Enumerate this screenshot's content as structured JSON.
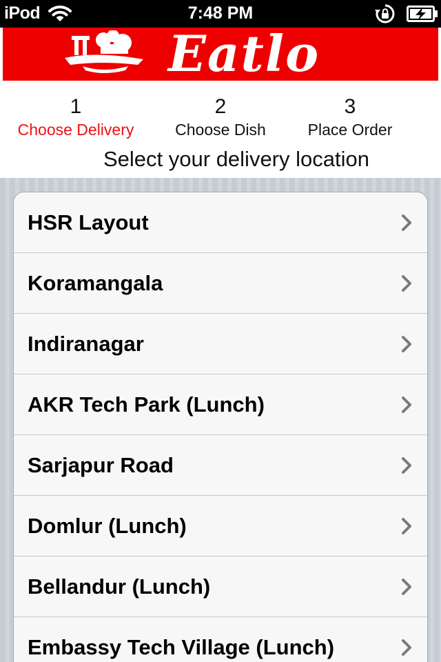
{
  "status_bar": {
    "carrier": "iPod",
    "time": "7:48 PM"
  },
  "brand": {
    "name": "Eatlo",
    "color": "#ee0000"
  },
  "steps": [
    {
      "number": "1",
      "label": "Choose Delivery",
      "active": true
    },
    {
      "number": "2",
      "label": "Choose Dish",
      "active": false
    },
    {
      "number": "3",
      "label": "Place Order",
      "active": false
    }
  ],
  "subtitle": "Select your delivery location",
  "locations": [
    {
      "name": "HSR Layout"
    },
    {
      "name": "Koramangala"
    },
    {
      "name": "Indiranagar"
    },
    {
      "name": "AKR Tech Park (Lunch)"
    },
    {
      "name": "Sarjapur Road"
    },
    {
      "name": "Domlur (Lunch)"
    },
    {
      "name": "Bellandur (Lunch)"
    },
    {
      "name": "Embassy Tech Village (Lunch)"
    }
  ],
  "icons": {
    "status": [
      "wifi-icon",
      "lock-rotation-icon",
      "battery-icon"
    ],
    "row_accessory": "chevron-right-icon"
  },
  "colors": {
    "active_step": "#ee1111",
    "accent_red": "#ee0000",
    "list_background": "#cbd2d8"
  }
}
